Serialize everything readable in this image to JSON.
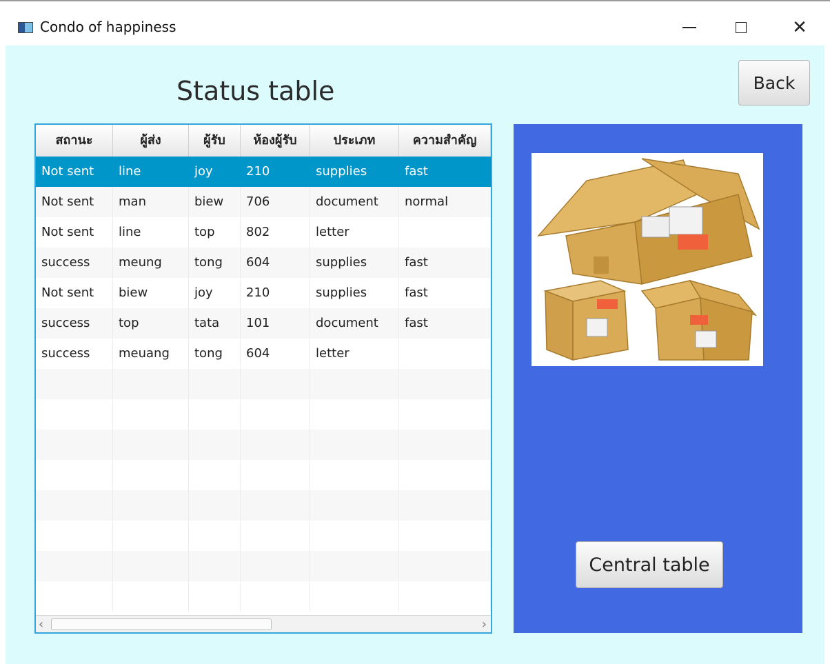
{
  "window": {
    "title": "Condo of happiness"
  },
  "page": {
    "title": "Status table",
    "back_label": "Back",
    "central_label": "Central table"
  },
  "table": {
    "columns": [
      "สถานะ",
      "ผู้ส่ง",
      "ผู้รับ",
      "ห้องผู้รับ",
      "ประเภท",
      "ความสำคัญ"
    ],
    "rows": [
      [
        "Not sent",
        "line",
        "joy",
        "210",
        "supplies",
        "fast"
      ],
      [
        "Not sent",
        "man",
        "biew",
        "706",
        "document",
        "normal"
      ],
      [
        "Not sent",
        "line",
        "top",
        "802",
        "letter",
        ""
      ],
      [
        "success",
        "meung",
        "tong",
        "604",
        "supplies",
        "fast"
      ],
      [
        "Not sent",
        "biew",
        "joy",
        "210",
        "supplies",
        "fast"
      ],
      [
        "success",
        "top",
        "tata",
        "101",
        "document",
        "fast"
      ],
      [
        "success",
        "meuang",
        "tong",
        "604",
        "letter",
        ""
      ]
    ],
    "selected_row": 0
  },
  "icons": {
    "app": "app-window-icon",
    "minimize": "minimize-icon",
    "maximize": "maximize-icon",
    "close": "close-icon",
    "scroll_left": "chevron-left-icon",
    "scroll_right": "chevron-right-icon",
    "boxes": "cardboard-boxes-image"
  },
  "colors": {
    "background": "#dcfbfd",
    "panel": "#4169e1",
    "selection": "#0096c9",
    "table_border": "#35a6dd"
  }
}
